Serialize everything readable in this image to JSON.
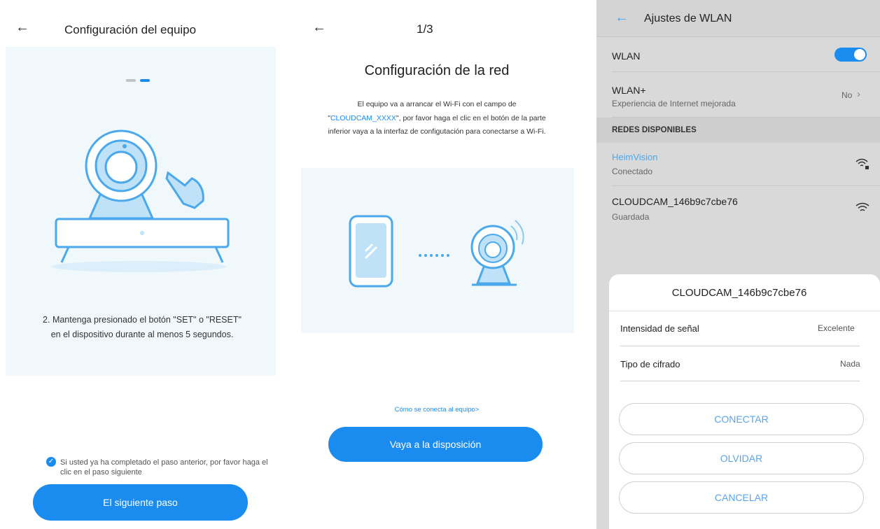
{
  "panel1": {
    "title": "Configuración del equipo",
    "instruction": "2. Mantenga presionado el botón \"SET\" o \"RESET\" en el dispositivo durante al menos 5 segundos.",
    "confirm_text": "Si usted ya ha completado el paso anterior, por favor haga el clic en el paso siguiente",
    "next_button": "El siguiente paso"
  },
  "panel2": {
    "step": "1/3",
    "heading": "Configuración de la red",
    "desc_before": "El equipo va a arrancar el Wi-Fi con el campo de \"",
    "desc_highlight": "CLOUDCAM_XXXX",
    "desc_after": "\", por favor haga el clic en el botón de la parte inferior vaya a la interfaz de configutación para conectarse a Wi-Fi.",
    "help_link": "Cómo se conecta al equipo>",
    "go_button": "Vaya a la disposición"
  },
  "panel3": {
    "title": "Ajustes de WLAN",
    "wlan_label": "WLAN",
    "wlan_plus_label": "WLAN+",
    "wlan_plus_sub": "Experiencia de Internet mejorada",
    "wlan_plus_value": "No",
    "section_header": "REDES DISPONIBLES",
    "networks": [
      {
        "name": "HeimVision",
        "status": "Conectado"
      },
      {
        "name": "CLOUDCAM_146b9c7cbe76",
        "status": "Guardada"
      }
    ],
    "sheet": {
      "title": "CLOUDCAM_146b9c7cbe76",
      "signal_label": "Intensidad de señal",
      "signal_value": "Excelente",
      "encryption_label": "Tipo de cifrado",
      "encryption_value": "Nada",
      "connect": "CONECTAR",
      "forget": "OLVIDAR",
      "cancel": "CANCELAR"
    }
  },
  "colors": {
    "accent": "#1a8cf0",
    "panel_bg": "#f0f8fb",
    "illustration_blue": "#4aa8ec",
    "illustration_fill": "#bfe2f8"
  }
}
